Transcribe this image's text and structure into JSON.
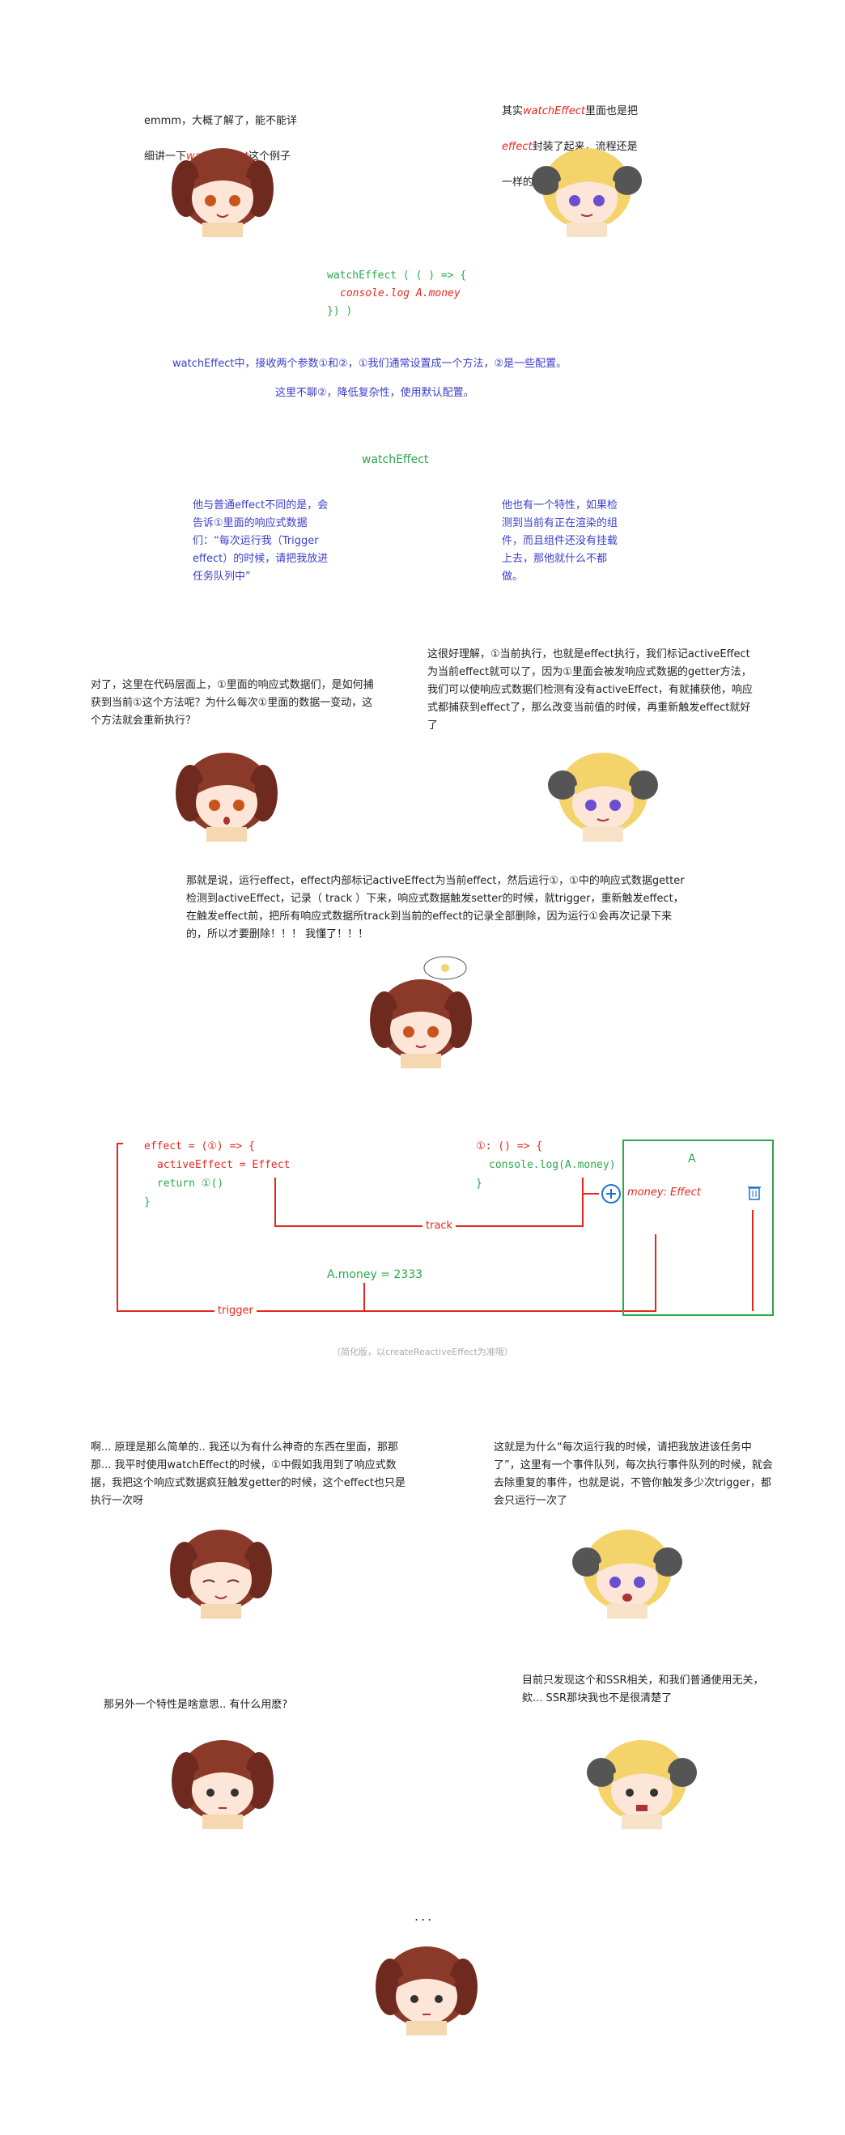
{
  "panel1": {
    "left_text_a": "emmm，大概了解了，能不能详",
    "left_text_b1": "细讲一下",
    "left_text_b_hl": "watchEffect",
    "left_text_b2": "这个例子",
    "right_text_a1": "其实",
    "right_text_a_hl": "watchEffect",
    "right_text_a2": "里面也是把",
    "right_text_b_hl": "effect",
    "right_text_b2": "封装了起来，流程还是",
    "right_text_c": "一样的流程"
  },
  "code1": {
    "l1": "watchEffect  ( ( ) => {",
    "l2": "console.log   A.money",
    "l3": "}) )"
  },
  "explain": {
    "line1": "watchEffect中，接收两个参数①和②，①我们通常设置成一个方法，②是一些配置。",
    "line2": "这里不聊②，降低复杂性，使用默认配置。"
  },
  "section_title": "watchEffect",
  "notes": {
    "left": "他与普通effect不同的是，会告诉①里面的响应式数据们：“每次运行我（Trigger effect）的时候，请把我放进任务队列中”",
    "right": "他也有一个特性，如果检测到当前有正在渲染的组件，而且组件还没有挂载上去，那他就什么不都做。"
  },
  "panel2": {
    "left": "对了，这里在代码层面上，①里面的响应式数据们，是如何捕获到当前①这个方法呢？为什么每次①里面的数据一变动，这个方法就会重新执行？",
    "right": "这很好理解，①当前执行，也就是effect执行，我们标记activeEffect为当前effect就可以了，因为①里面会被发响应式数据的getter方法，我们可以使响应式数据们检测有没有activeEffect，有就捕获他，响应式都捕获到effect了，那么改变当前值的时候，再重新触发effect就好了"
  },
  "panel3": {
    "text": "那就是说，运行effect，effect内部标记activeEffect为当前effect，然后运行①，①中的响应式数据getter检测到activeEffect，记录（ track ）下来，响应式数据触发setter的时候，就trigger，重新触发effect，在触发effect前，把所有响应式数据所track到当前的effect的记录全部删除，因为运行①会再次记录下来的，所以才要删除！！！  我懂了！！！"
  },
  "diagram": {
    "effect_l1": "effect = (①) => {",
    "effect_l2": "activeEffect = Effect",
    "effect_l3": "return ①()",
    "effect_l4": "}",
    "fn_l1": "①: () => {",
    "fn_l2": "console.log(A.money)",
    "fn_l3": "}",
    "box_title": "A",
    "box_entry": "money: Effect",
    "track_label": "track",
    "assign": "A.money = 2333",
    "trigger_label": "trigger",
    "caption": "（简化版，以createReactiveEffect为准哦）",
    "colors": {
      "red": "#e4281f",
      "green": "#2aa84a",
      "blue": "#1f6fd1"
    }
  },
  "panel4": {
    "left": "啊... 原理是那么简单的.. 我还以为有什么神奇的东西在里面，那那那... 我平时使用watchEffect的时候，①中假如我用到了响应式数据，我把这个响应式数据疯狂触发getter的时候，这个effect也只是执行一次呀",
    "right": "这就是为什么“每次运行我的时候，请把我放进该任务中了”，这里有一个事件队列，每次执行事件队列的时候，就会去除重复的事件，也就是说，不管你触发多少次trigger，都会只运行一次了"
  },
  "panel5": {
    "left": "那另外一个特性是啥意思.. 有什么用麽?",
    "right": "目前只发现这个和SSR相关，和我们普通使用无关，欸... SSR那块我也不是很清楚了"
  },
  "ending": {
    "dots": "..."
  }
}
